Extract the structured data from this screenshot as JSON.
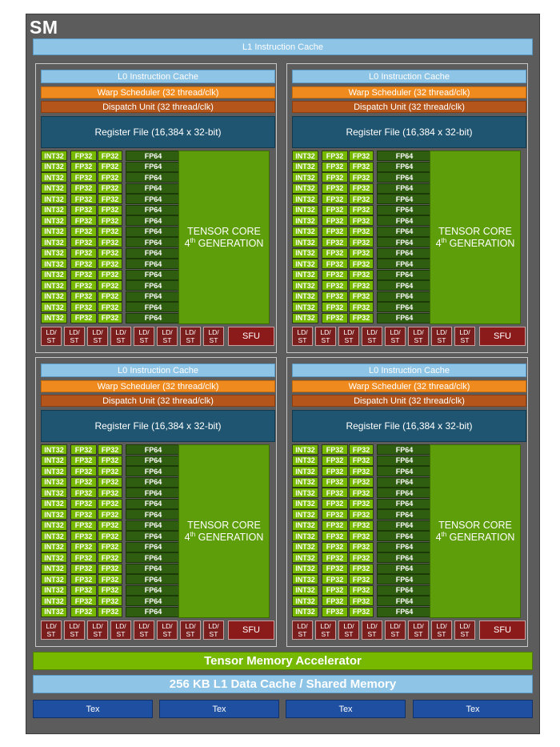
{
  "sm": {
    "title": "SM",
    "l1_instruction_cache": "L1 Instruction Cache",
    "tensor_memory_accelerator": "Tensor Memory Accelerator",
    "l1_data_cache": "256 KB L1 Data Cache / Shared Memory",
    "tex_units": [
      "Tex",
      "Tex",
      "Tex",
      "Tex"
    ]
  },
  "quadrant": {
    "l0_cache": "L0 Instruction Cache",
    "warp_scheduler": "Warp Scheduler (32 thread/clk)",
    "dispatch_unit": "Dispatch Unit (32 thread/clk)",
    "register_file": "Register File (16,384 x 32-bit)",
    "int32_label": "INT32",
    "fp32_label": "FP32",
    "fp64_label": "FP64",
    "row_count": 16,
    "tensor_core_line1": "TENSOR CORE",
    "tensor_core_gen_num": "4",
    "tensor_core_gen_sup": "th",
    "tensor_core_gen_rest": " GENERATION",
    "ldst_top": "LD/",
    "ldst_bottom": "ST",
    "ldst_count": 8,
    "sfu_label": "SFU"
  },
  "colors": {
    "sm_background": "#5c5c5c",
    "cache_blue": "#8ec4e6",
    "warp_orange": "#ef8a1f",
    "dispatch_brown": "#b4561b",
    "register_teal": "#1f5570",
    "core_green": "#76b900",
    "fp64_dark_green": "#2f5e10",
    "tensor_green": "#5e9e0a",
    "ldst_red": "#7a1e1e",
    "tex_blue": "#1f4fa0"
  }
}
